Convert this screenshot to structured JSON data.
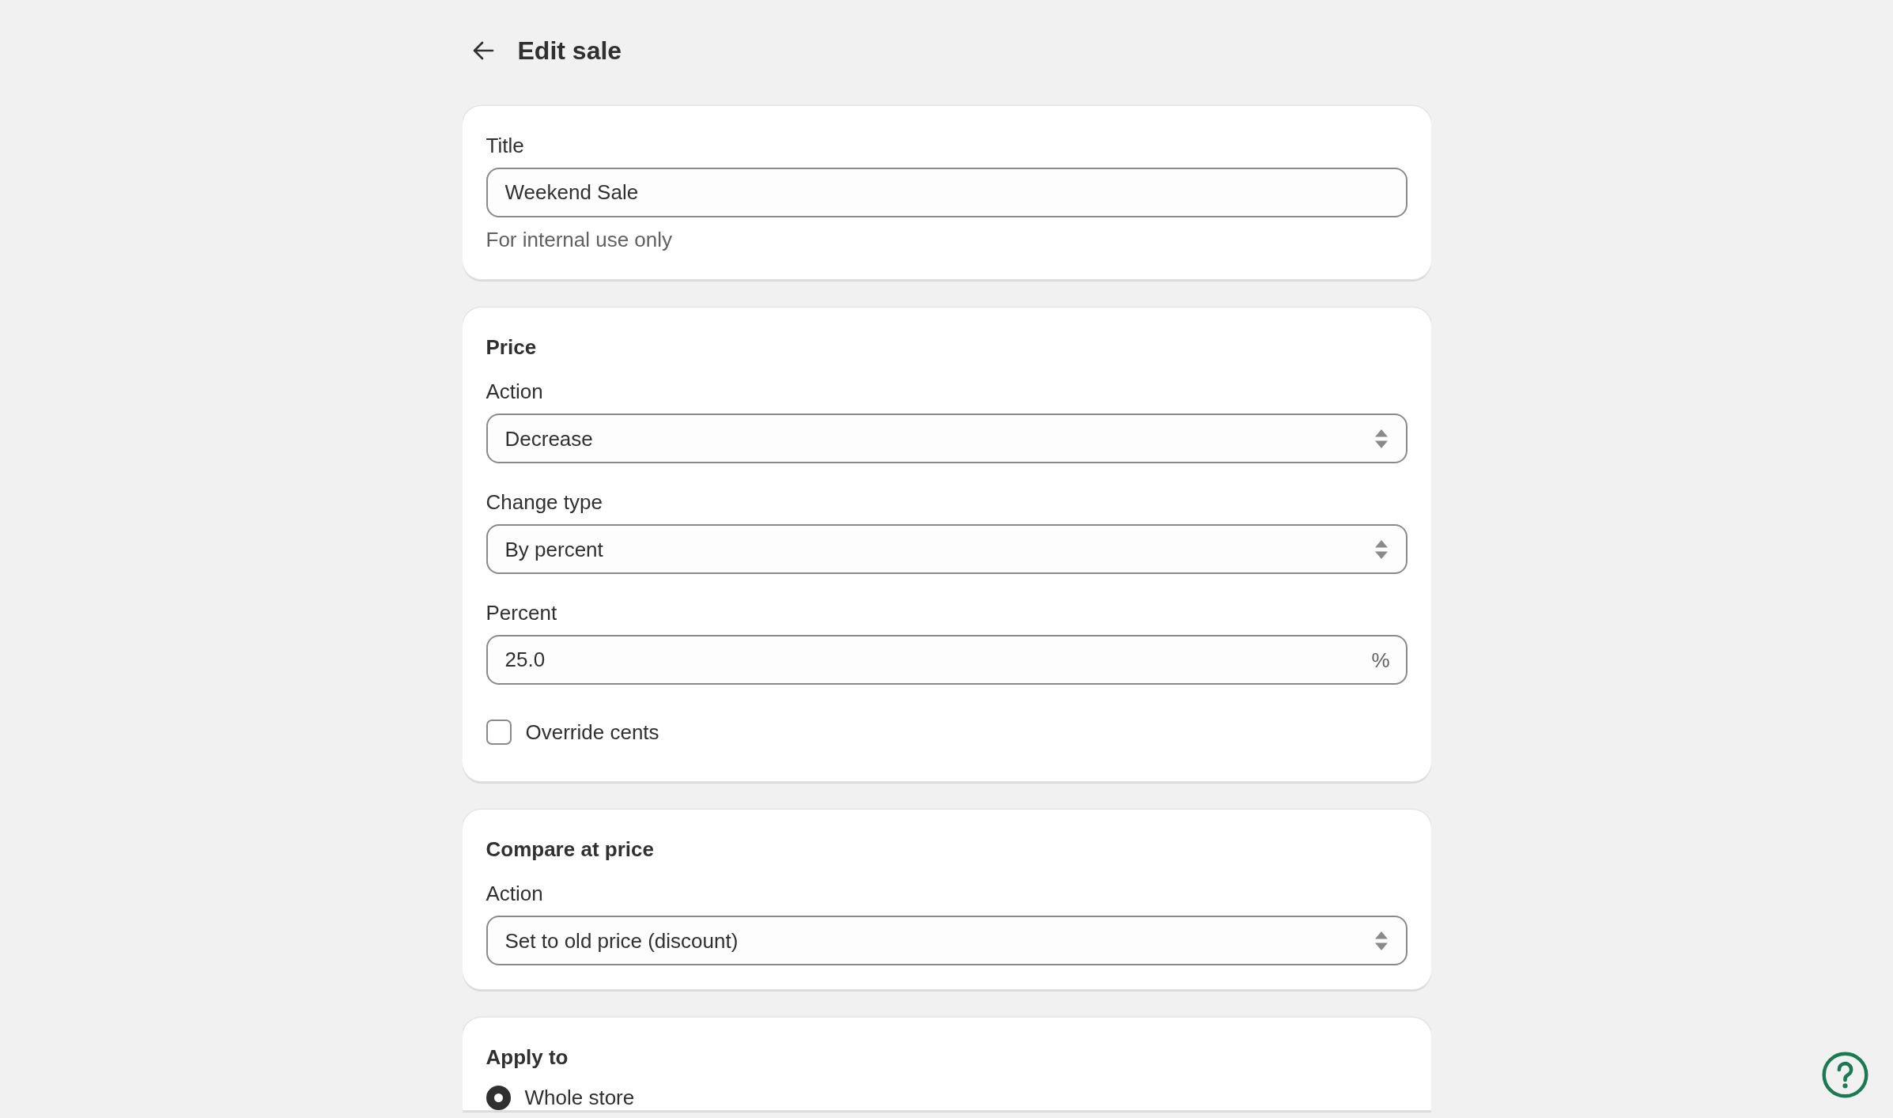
{
  "page": {
    "title": "Edit sale"
  },
  "cards": [
    {
      "fields": [
        {
          "kind": "text",
          "label": "Title",
          "value": "Weekend Sale",
          "help": "For internal use only"
        }
      ]
    },
    {
      "heading": "Price",
      "fields": [
        {
          "kind": "select",
          "label": "Action",
          "value": "Decrease"
        },
        {
          "kind": "select",
          "label": "Change type",
          "value": "By percent"
        },
        {
          "kind": "text",
          "label": "Percent",
          "value": "25.0",
          "suffix": "%"
        },
        {
          "kind": "checkbox",
          "label": "Override cents",
          "checked": false
        }
      ]
    },
    {
      "heading": "Compare at price",
      "fields": [
        {
          "kind": "select",
          "label": "Action",
          "value": "Set to old price (discount)"
        }
      ]
    },
    {
      "heading": "Apply to",
      "fields": [
        {
          "kind": "radio",
          "label": "Whole store",
          "selected": true
        }
      ]
    }
  ]
}
